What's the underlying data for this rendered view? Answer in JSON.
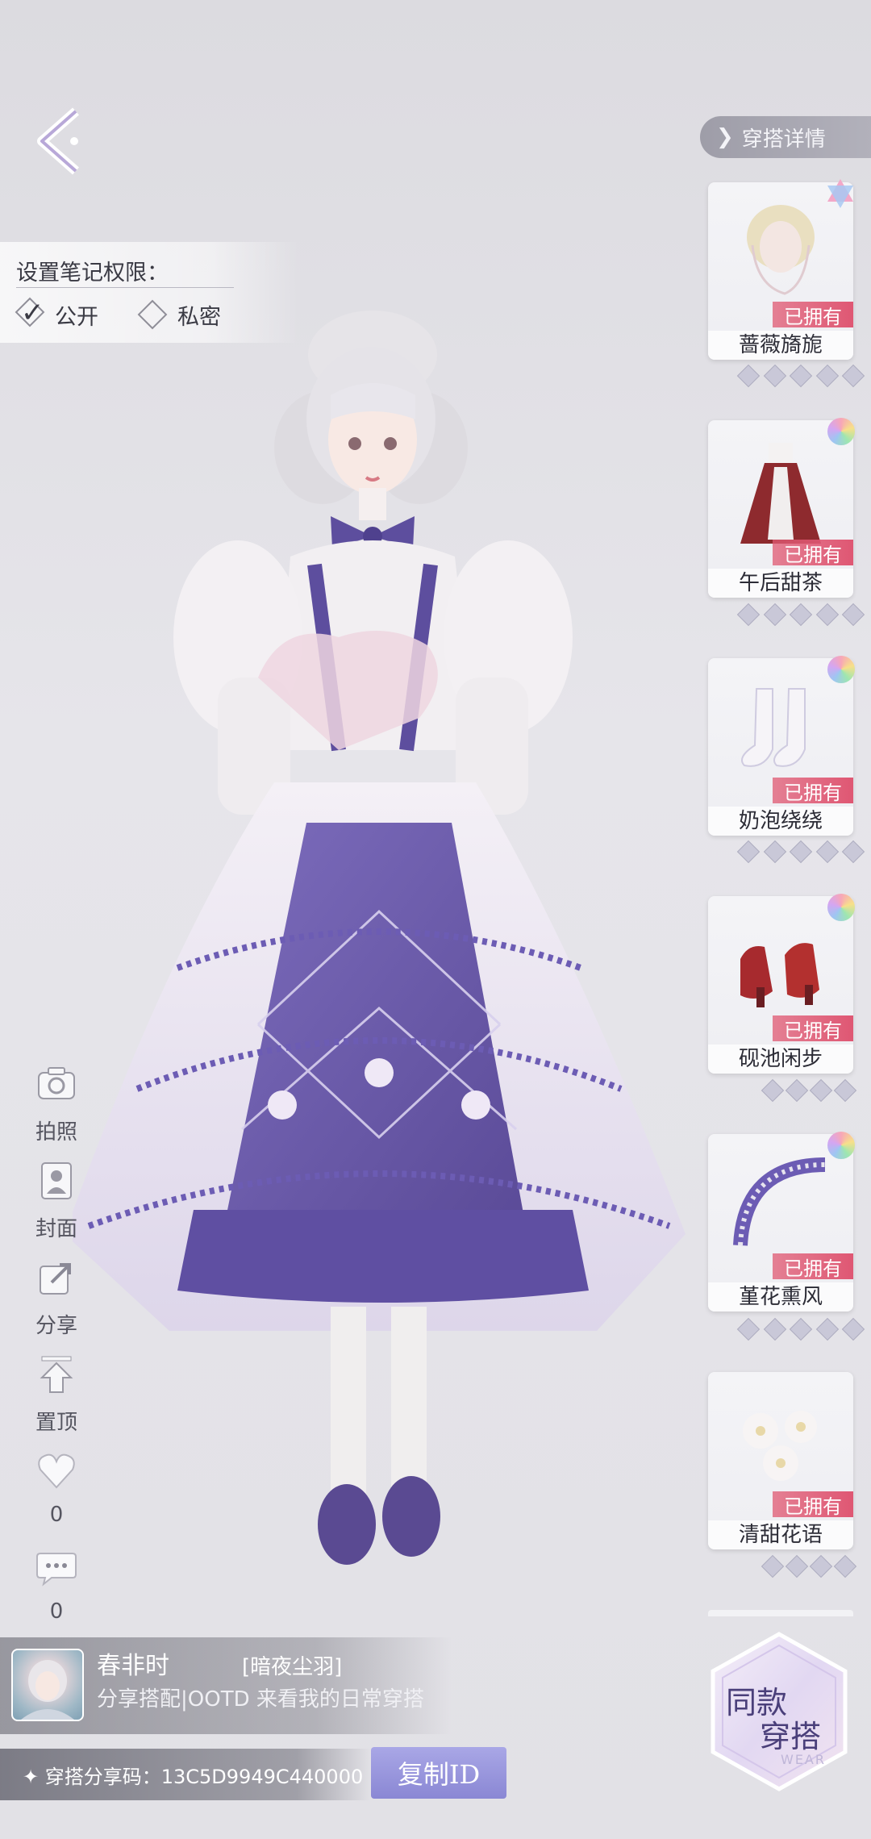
{
  "permission": {
    "title": "设置笔记权限：",
    "options": [
      {
        "label": "公开",
        "checked": true
      },
      {
        "label": "私密",
        "checked": false
      }
    ]
  },
  "header": {
    "details_label": "穿搭详情"
  },
  "items": [
    {
      "name": "蔷薇旖旎",
      "status": "已拥有",
      "badge": "star-badge-icon"
    },
    {
      "name": "午后甜茶",
      "status": "已拥有",
      "badge": "rainbow-badge-icon"
    },
    {
      "name": "奶泡绕绕",
      "status": "已拥有",
      "badge": "rainbow-badge-icon"
    },
    {
      "name": "砚池闲步",
      "status": "已拥有",
      "badge": "rainbow-badge-icon"
    },
    {
      "name": "堇花熏风",
      "status": "已拥有",
      "badge": "rainbow-badge-icon"
    },
    {
      "name": "清甜花语",
      "status": "已拥有",
      "badge": null
    }
  ],
  "actions": {
    "photo": "拍照",
    "cover": "封面",
    "share": "分享",
    "pin": "置顶",
    "likes": "0",
    "comments": "0"
  },
  "post": {
    "username": "春非时",
    "tag": "[暗夜尘羽]",
    "description": "分享搭配|OOTD 来看我的日常穿搭"
  },
  "share_code": {
    "label": "✦ 穿搭分享码：13C5D9949C440000",
    "copy_button": "复制ID"
  },
  "same_outfit": {
    "line1": "同款",
    "line2": "穿搭",
    "watermark": "WEAR"
  },
  "colors": {
    "accent_purple": "#8a87d4",
    "owned_red": "#df5773",
    "dress_purple": "#6b5aa8"
  }
}
